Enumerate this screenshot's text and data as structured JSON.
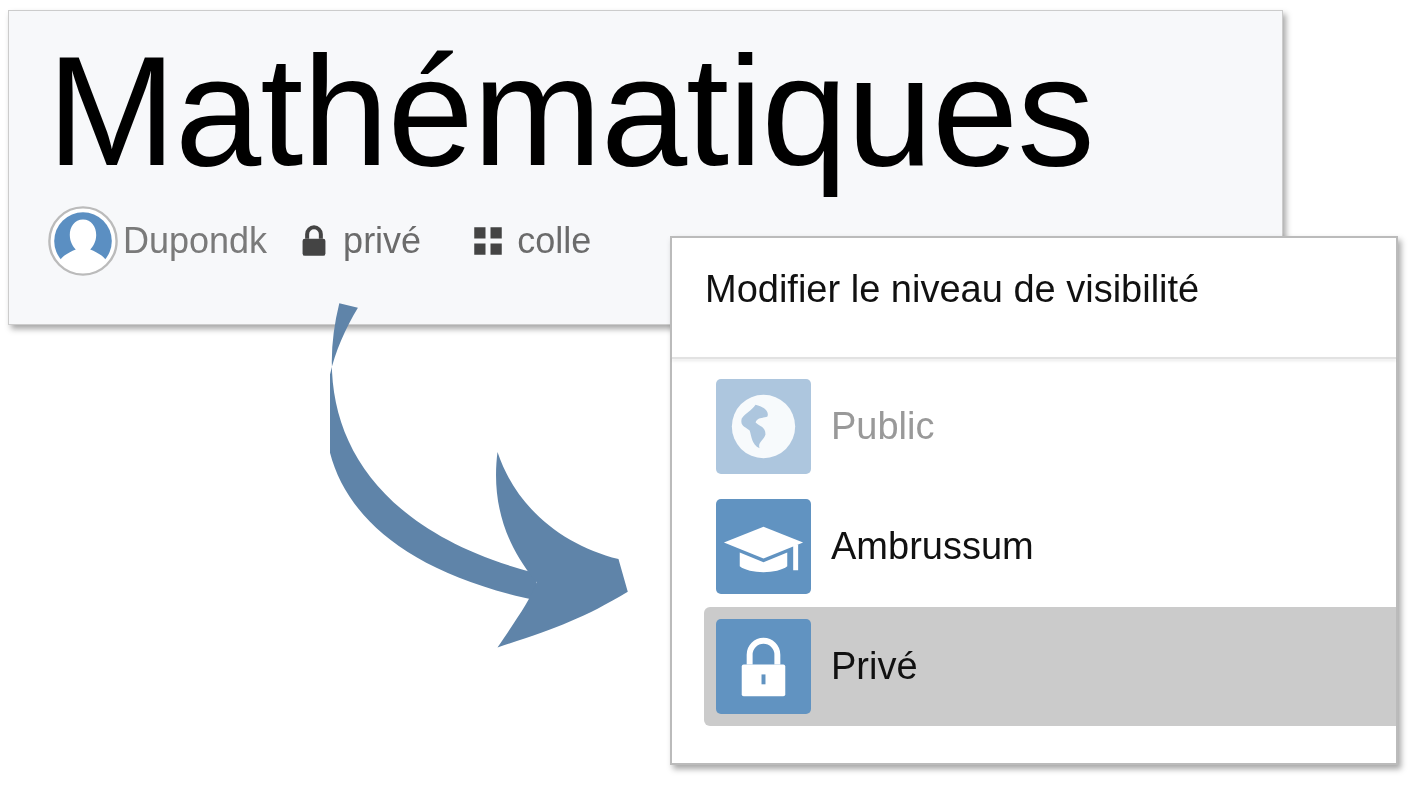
{
  "header": {
    "title": "Mathématiques",
    "author": "Dupondk",
    "visibility": "privé",
    "collection": "colle"
  },
  "popup": {
    "title": "Modifier le niveau de visibilité",
    "options": [
      {
        "label": "Public",
        "kind": "globe",
        "disabled": true,
        "selected": false
      },
      {
        "label": "Ambrussum",
        "kind": "cap",
        "disabled": false,
        "selected": false
      },
      {
        "label": "Privé",
        "kind": "lock",
        "disabled": false,
        "selected": true
      }
    ]
  }
}
